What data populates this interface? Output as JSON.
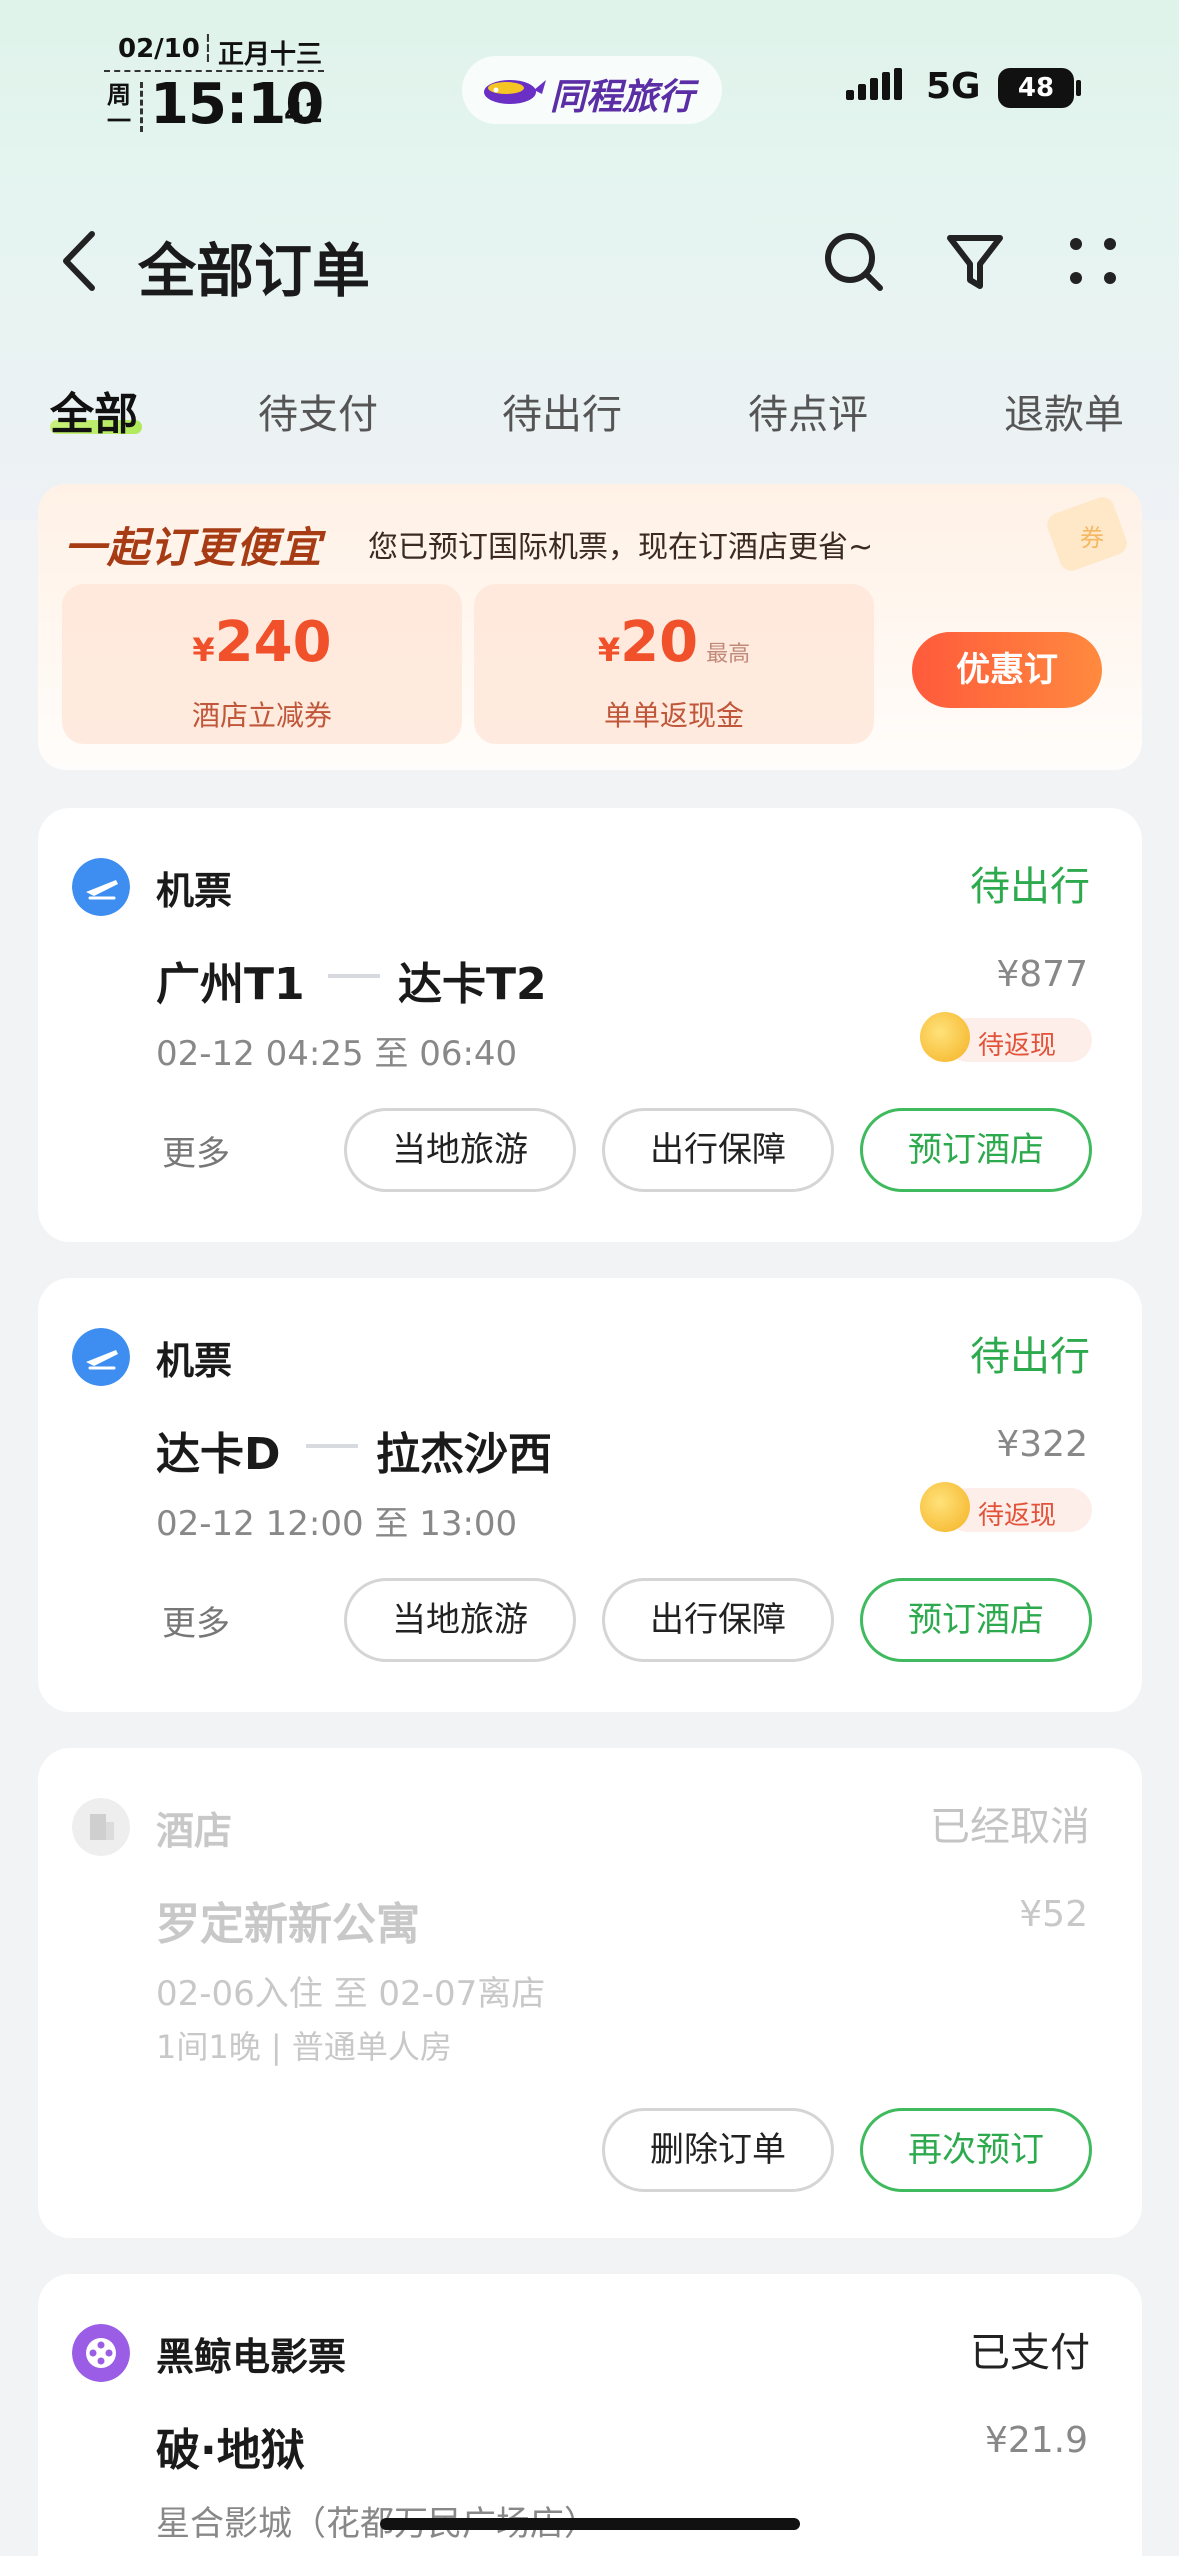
{
  "status_bar": {
    "date": "02/10",
    "lunar": "正月十三",
    "weekday": "周一",
    "time": "15:10",
    "seconds": "41",
    "network": "5G",
    "battery": "48"
  },
  "brand": {
    "name": "同程旅行"
  },
  "header": {
    "title": "全部订单"
  },
  "tabs": [
    {
      "label": "全部",
      "active": true
    },
    {
      "label": "待支付"
    },
    {
      "label": "待出行"
    },
    {
      "label": "待点评"
    },
    {
      "label": "退款单"
    }
  ],
  "promo": {
    "title": "一起订更便宜",
    "subtitle": "您已预订国际机票，现在订酒店更省~",
    "coupons": [
      {
        "currency": "¥",
        "amount": "240",
        "note": "",
        "label": "酒店立减券"
      },
      {
        "currency": "¥",
        "amount": "20",
        "note": "最高",
        "label": "单单返现金"
      }
    ],
    "button": "优惠订"
  },
  "orders": [
    {
      "type": "机票",
      "status": "待出行",
      "from": "广州T1",
      "to": "达卡T2",
      "price": "¥877",
      "time": "02-12 04:25 至 06:40",
      "cashback": "待返现",
      "more": "更多",
      "buttons": [
        "当地旅游",
        "出行保障",
        "预订酒店"
      ]
    },
    {
      "type": "机票",
      "status": "待出行",
      "from": "达卡D",
      "to": "拉杰沙西",
      "price": "¥322",
      "time": "02-12 12:00 至 13:00",
      "cashback": "待返现",
      "more": "更多",
      "buttons": [
        "当地旅游",
        "出行保障",
        "预订酒店"
      ]
    },
    {
      "type": "酒店",
      "status": "已经取消",
      "name": "罗定新新公寓",
      "price": "¥52",
      "dates": "02-06入住 至 02-07离店",
      "room": "1间1晚 | 普通单人房",
      "buttons": [
        "删除订单",
        "再次预订"
      ]
    },
    {
      "type": "黑鲸电影票",
      "status": "已支付",
      "name": "破·地狱",
      "price": "¥21.9",
      "cinema": "星合影城（花都万民广场店）"
    }
  ],
  "colors": {
    "green": "#2eaa4e",
    "orange": "#f0502a",
    "gray_text": "#888888",
    "card_bg": "#ffffff"
  }
}
